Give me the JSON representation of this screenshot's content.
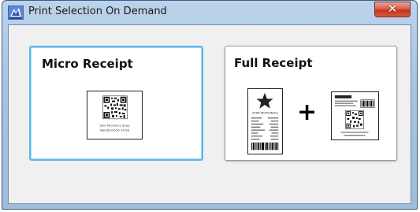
{
  "window": {
    "title": "Print Selection On Demand",
    "close_glyph": "✕",
    "app_icon": "print-selection-app-icon"
  },
  "options": [
    {
      "title": "Micro Receipt",
      "caption_line1": "Star Micronics Shop",
      "caption_line2": "Nov/02/2016 14:00"
    },
    {
      "title": "Full Receipt",
      "receipt_header": "STAR MICRONICS",
      "plus": "+"
    }
  ],
  "colors": {
    "selected_border": "#5cb6ec",
    "close_button": "#c2361e",
    "titlebar": "#a9c4e2"
  }
}
